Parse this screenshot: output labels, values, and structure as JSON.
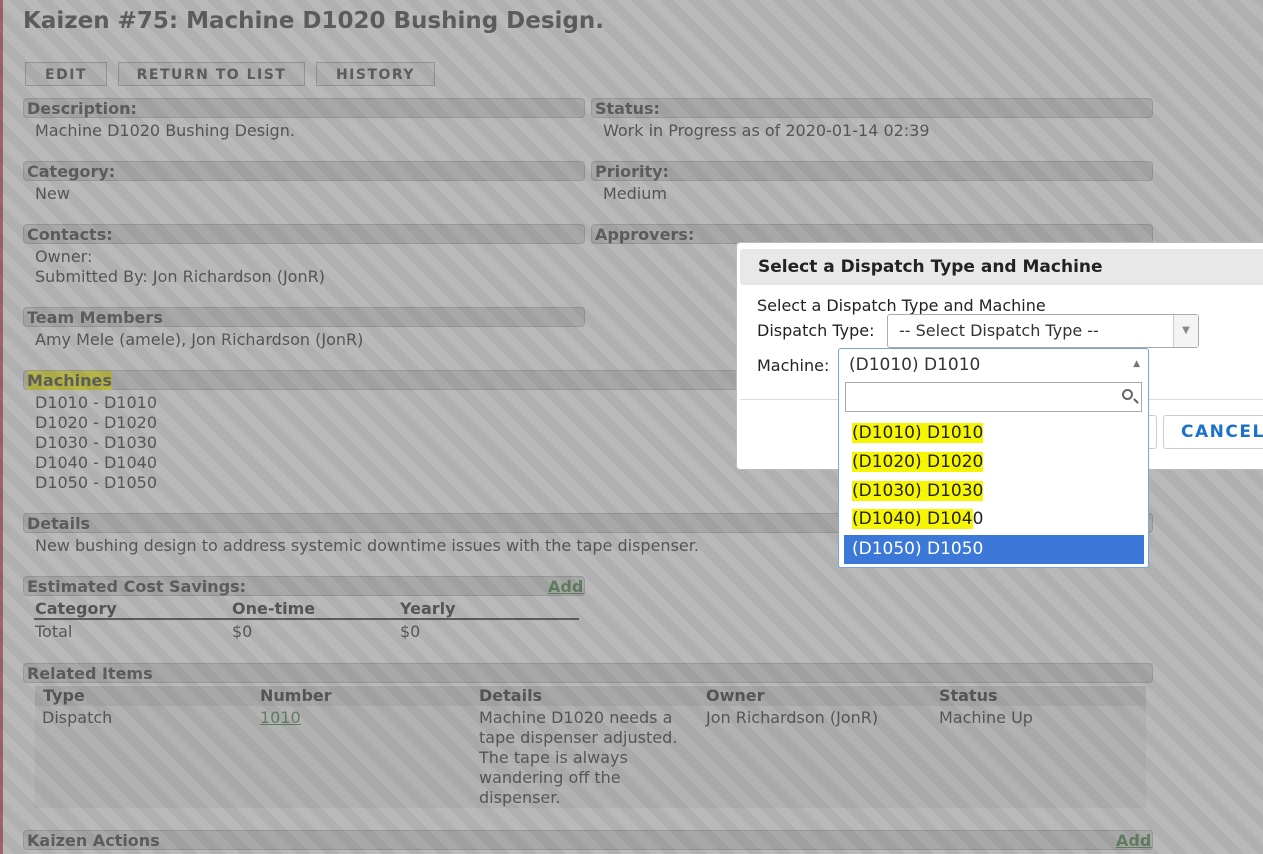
{
  "page": {
    "title": "Kaizen #75: Machine D1020 Bushing Design.",
    "buttons": {
      "edit": "EDIT",
      "return": "RETURN TO LIST",
      "history": "HISTORY"
    },
    "description": {
      "label": "Description:",
      "value": "Machine D1020 Bushing Design."
    },
    "status": {
      "label": "Status:",
      "value": "Work in Progress as of 2020-01-14 02:39"
    },
    "category": {
      "label": "Category:",
      "value": "New"
    },
    "priority": {
      "label": "Priority:",
      "value": "Medium"
    },
    "contacts": {
      "label": "Contacts:",
      "owner": "Owner:",
      "submitted": "Submitted By: Jon Richardson (JonR)"
    },
    "approvers": {
      "label": "Approvers:"
    },
    "team": {
      "label": "Team Members",
      "value": "Amy Mele (amele), Jon Richardson (JonR)"
    },
    "machines": {
      "label": "Machines",
      "items": [
        "D1010 - D1010",
        "D1020 - D1020",
        "D1030 - D1030",
        "D1040 - D1040",
        "D1050 - D1050"
      ]
    },
    "details": {
      "label": "Details",
      "value": "New bushing design to address systemic downtime issues with the tape dispenser."
    },
    "savings": {
      "label": "Estimated Cost Savings:",
      "add": "Add",
      "columns": [
        "Category",
        "One-time",
        "Yearly"
      ],
      "row": [
        "Total",
        "$0",
        "$0"
      ]
    },
    "related": {
      "label": "Related Items",
      "columns": [
        "Type",
        "Number",
        "Details",
        "Owner",
        "Status"
      ],
      "row": {
        "type": "Dispatch",
        "number": "1010",
        "details": [
          "Machine D1020 needs a",
          "tape dispenser adjusted.",
          "The tape is always",
          "wandering off the",
          "dispenser."
        ],
        "owner": "Jon Richardson (JonR)",
        "status": "Machine Up"
      }
    },
    "actions": {
      "label": "Kaizen Actions",
      "add": "Add"
    }
  },
  "dialog": {
    "title": "Select a Dispatch Type and Machine",
    "subtitle": "Select a Dispatch Type and Machine",
    "dispatch_label": "Dispatch Type:",
    "dispatch_value": "-- Select Dispatch Type --",
    "machine_label": "Machine:",
    "machine_value": "(D1010) D1010",
    "cancel": "CANCEL",
    "options": [
      "(D1010) D1010",
      "(D1020) D1020",
      "(D1030) D1030",
      "(D1040) D104",
      "0",
      "(D1050) D1050"
    ],
    "selected_option": "(D1050) D1050"
  },
  "colors": {
    "highlight": "#f6f600",
    "selected": "#3b78d8",
    "link": "#3a7a3a",
    "cancel": "#1a73c8"
  }
}
